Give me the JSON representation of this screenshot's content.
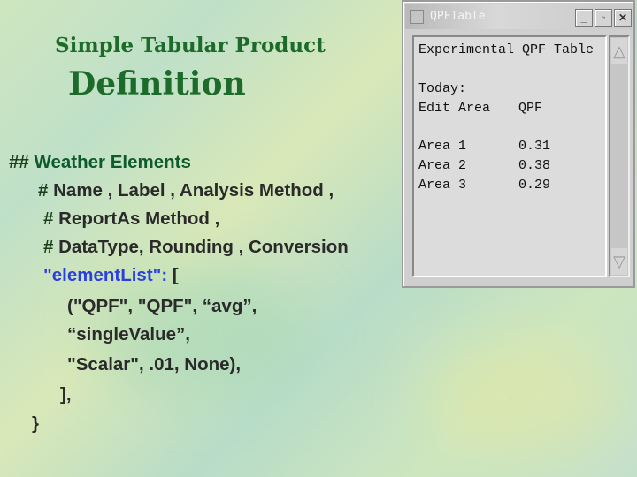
{
  "slide": {
    "title_line1": "Simple Tabular Product",
    "title_line2": "Definition"
  },
  "code": {
    "l1_hash": "##",
    "l1_text": "Weather Elements",
    "l2_hash": "#",
    "l2_text": "Name , Label , Analysis Method ,",
    "l3_hash": "#",
    "l3_text": "ReportAs Method ,",
    "l4_hash": "#",
    "l4_text": "DataType, Rounding , Conversion",
    "l5_key": "\"elementList\":",
    "l5_bracket": "[",
    "l6": "(\"QPF\", \"QPF\", “avg”,",
    "l7": "“singleValue”,",
    "l8": "\"Scalar\", .01, None),",
    "l9": "],",
    "l10": "}"
  },
  "window": {
    "title": "QPFTable",
    "minimize": "_",
    "maximize": "▫",
    "close": "✕",
    "heading": "Experimental QPF Table",
    "today": "Today:",
    "col_area": "Edit Area",
    "col_qpf": "QPF",
    "rows": [
      {
        "area": "Area 1",
        "qpf": "0.31"
      },
      {
        "area": "Area 2",
        "qpf": "0.38"
      },
      {
        "area": "Area 3",
        "qpf": "0.29"
      }
    ],
    "scroll_up": "△",
    "scroll_down": "▽"
  }
}
